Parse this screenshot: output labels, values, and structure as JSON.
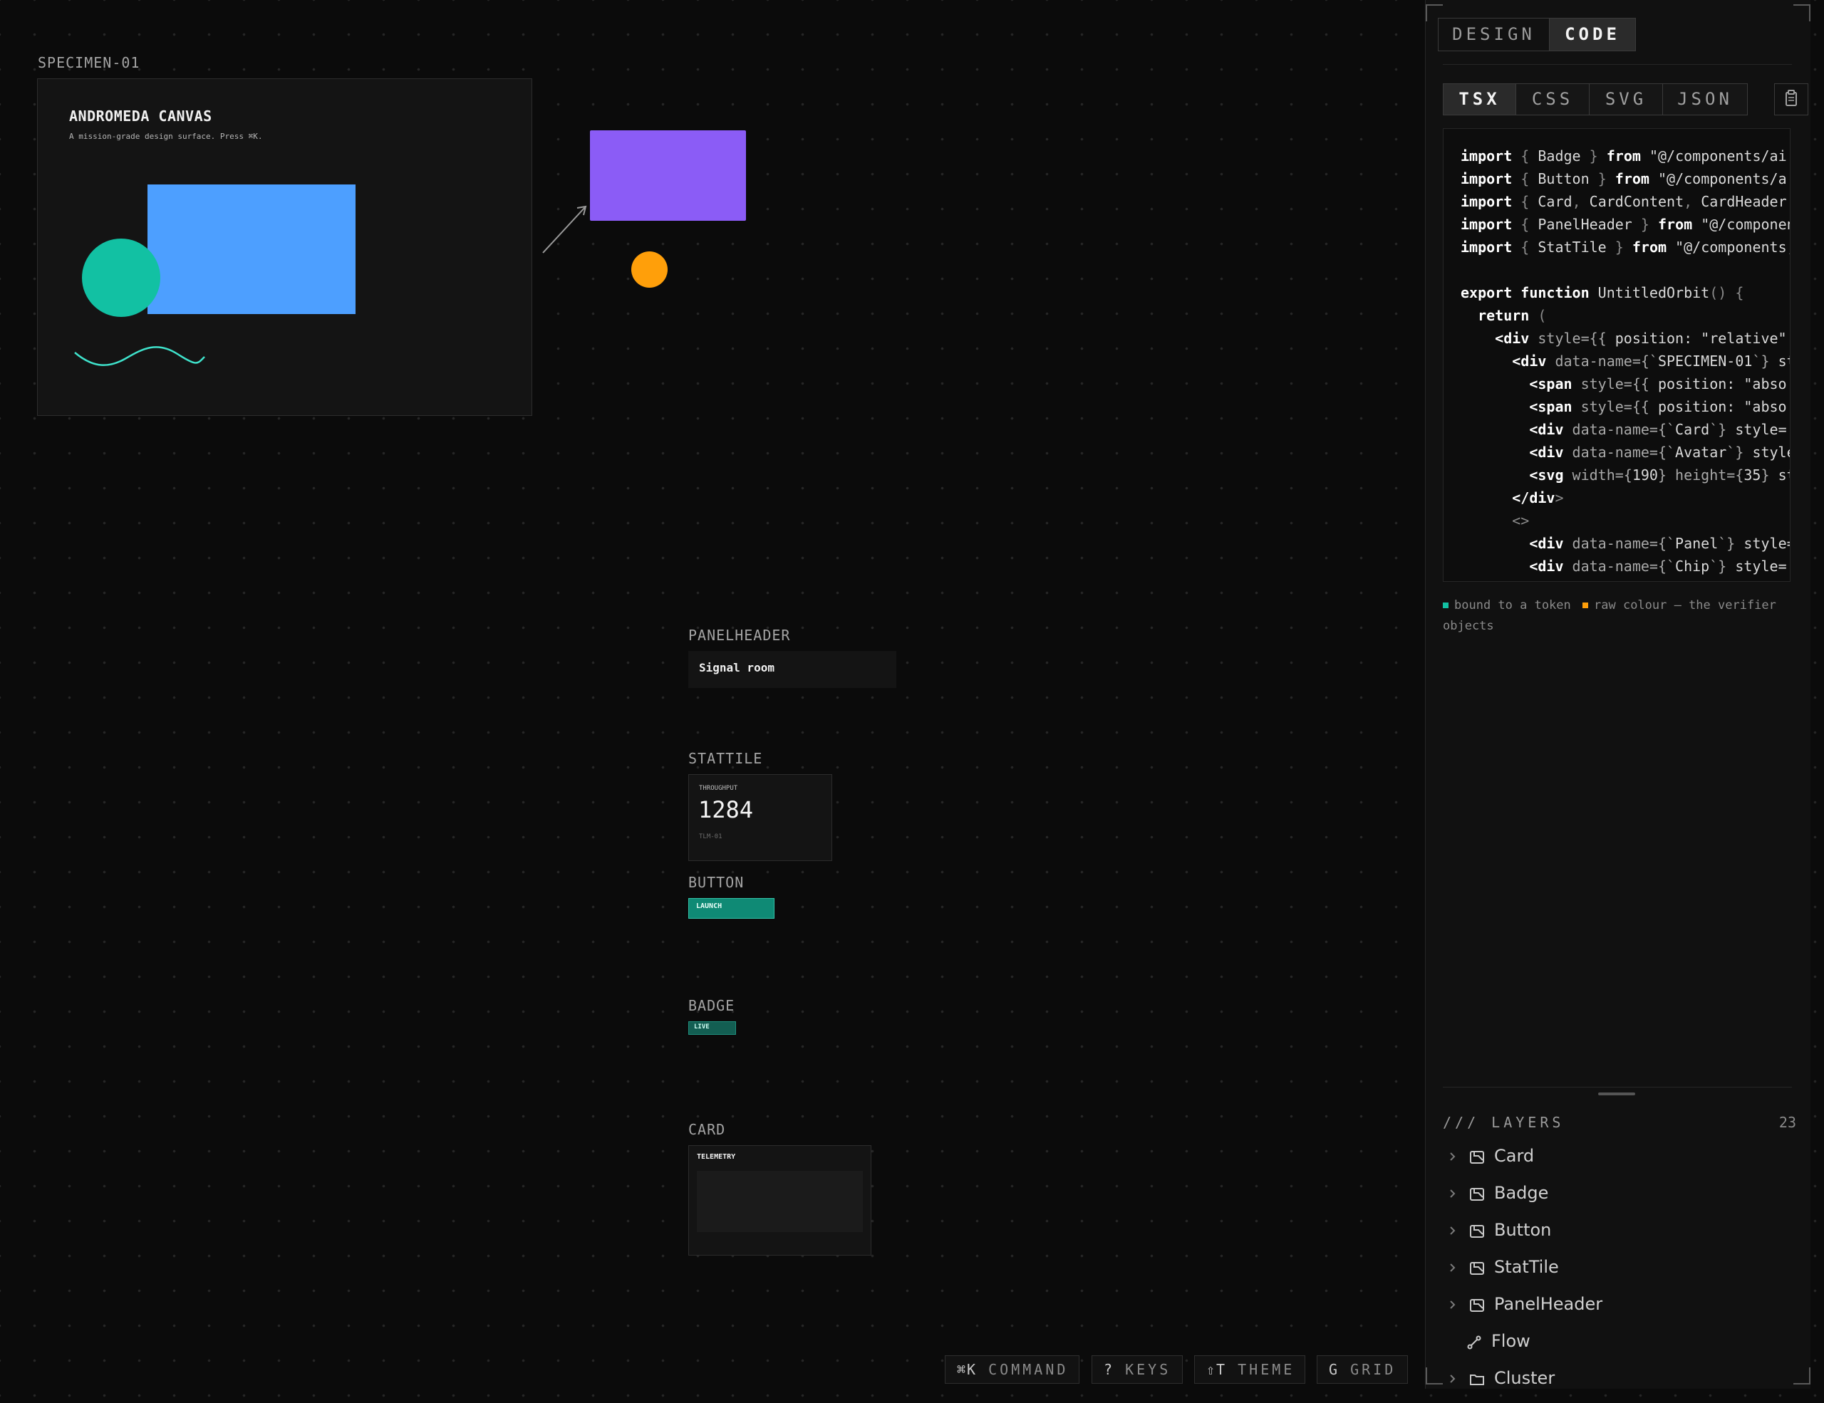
{
  "canvas": {
    "specimen_label": "SPECIMEN-01",
    "title": "ANDROMEDA CANVAS",
    "subtitle": "A mission-grade design surface. Press ⌘K.",
    "colors": {
      "blue": "#4d9fff",
      "teal": "#12c1a3",
      "purple": "#8b5cf6",
      "orange": "#ff9f0a"
    }
  },
  "components": {
    "panelheader": {
      "label": "PANELHEADER",
      "text": "Signal room"
    },
    "stattile": {
      "label": "STATTILE",
      "caption": "THROUGHPUT",
      "value": "1284",
      "id": "TLM-01"
    },
    "button": {
      "label": "BUTTON",
      "text": "LAUNCH"
    },
    "badge": {
      "label": "BADGE",
      "text": "LIVE"
    },
    "card": {
      "label": "CARD",
      "title": "TELEMETRY"
    }
  },
  "toolbar": [
    {
      "key": "⌘K",
      "label": "COMMAND"
    },
    {
      "key": "?",
      "label": "KEYS"
    },
    {
      "key": "⇧T",
      "label": "THEME"
    },
    {
      "key": "G",
      "label": "GRID"
    }
  ],
  "panel": {
    "mode_tabs": [
      {
        "label": "DESIGN",
        "active": false
      },
      {
        "label": "CODE",
        "active": true
      }
    ],
    "lang_tabs": [
      {
        "label": "TSX",
        "active": true
      },
      {
        "label": "CSS",
        "active": false
      },
      {
        "label": "SVG",
        "active": false
      },
      {
        "label": "JSON",
        "active": false
      }
    ],
    "copy_icon": "clipboard-icon",
    "code": [
      "import { Badge } from \"@/components/ai",
      "import { Button } from \"@/components/a",
      "import { Card, CardContent, CardHeader",
      "import { PanelHeader } from \"@/componen",
      "import { StatTile } from \"@/components,",
      "",
      "export function UntitledOrbit() {",
      "  return (",
      "    <div style={{ position: \"relative\"",
      "      <div data-name={`SPECIMEN-01`} st",
      "        <span style={{ position: \"abso",
      "        <span style={{ position: \"abso",
      "        <div data-name={`Card`} style=",
      "        <div data-name={`Avatar`} style",
      "        <svg width={190} height={35} st",
      "      </div>",
      "      <>",
      "        <div data-name={`Panel`} style=",
      "        <div data-name={`Chip`} style="
    ],
    "legend": {
      "token": "bound to a token",
      "raw": "raw colour — the verifier objects",
      "token_color": "#12c1a3",
      "raw_color": "#ff9f0a"
    },
    "layers": {
      "title": "/// LAYERS",
      "count": "23",
      "items": [
        {
          "name": "Card",
          "icon": "component-icon",
          "expandable": true
        },
        {
          "name": "Badge",
          "icon": "component-icon",
          "expandable": true
        },
        {
          "name": "Button",
          "icon": "component-icon",
          "expandable": true
        },
        {
          "name": "StatTile",
          "icon": "component-icon",
          "expandable": true
        },
        {
          "name": "PanelHeader",
          "icon": "component-icon",
          "expandable": true
        },
        {
          "name": "Flow",
          "icon": "connector-icon",
          "expandable": false
        },
        {
          "name": "Cluster",
          "icon": "folder-icon",
          "expandable": true
        }
      ]
    }
  }
}
